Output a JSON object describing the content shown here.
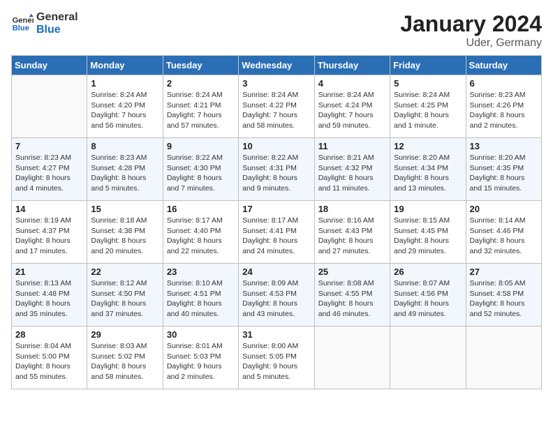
{
  "logo": {
    "line1": "General",
    "line2": "Blue"
  },
  "title": "January 2024",
  "subtitle": "Uder, Germany",
  "weekdays": [
    "Sunday",
    "Monday",
    "Tuesday",
    "Wednesday",
    "Thursday",
    "Friday",
    "Saturday"
  ],
  "weeks": [
    [
      {
        "day": "",
        "empty": true
      },
      {
        "day": "1",
        "sunrise": "8:24 AM",
        "sunset": "4:20 PM",
        "daylight": "7 hours and 56 minutes."
      },
      {
        "day": "2",
        "sunrise": "8:24 AM",
        "sunset": "4:21 PM",
        "daylight": "7 hours and 57 minutes."
      },
      {
        "day": "3",
        "sunrise": "8:24 AM",
        "sunset": "4:22 PM",
        "daylight": "7 hours and 58 minutes."
      },
      {
        "day": "4",
        "sunrise": "8:24 AM",
        "sunset": "4:24 PM",
        "daylight": "7 hours and 59 minutes."
      },
      {
        "day": "5",
        "sunrise": "8:24 AM",
        "sunset": "4:25 PM",
        "daylight": "8 hours and 1 minute."
      },
      {
        "day": "6",
        "sunrise": "8:23 AM",
        "sunset": "4:26 PM",
        "daylight": "8 hours and 2 minutes."
      }
    ],
    [
      {
        "day": "7",
        "sunrise": "8:23 AM",
        "sunset": "4:27 PM",
        "daylight": "8 hours and 4 minutes."
      },
      {
        "day": "8",
        "sunrise": "8:23 AM",
        "sunset": "4:28 PM",
        "daylight": "8 hours and 5 minutes."
      },
      {
        "day": "9",
        "sunrise": "8:22 AM",
        "sunset": "4:30 PM",
        "daylight": "8 hours and 7 minutes."
      },
      {
        "day": "10",
        "sunrise": "8:22 AM",
        "sunset": "4:31 PM",
        "daylight": "8 hours and 9 minutes."
      },
      {
        "day": "11",
        "sunrise": "8:21 AM",
        "sunset": "4:32 PM",
        "daylight": "8 hours and 11 minutes."
      },
      {
        "day": "12",
        "sunrise": "8:20 AM",
        "sunset": "4:34 PM",
        "daylight": "8 hours and 13 minutes."
      },
      {
        "day": "13",
        "sunrise": "8:20 AM",
        "sunset": "4:35 PM",
        "daylight": "8 hours and 15 minutes."
      }
    ],
    [
      {
        "day": "14",
        "sunrise": "8:19 AM",
        "sunset": "4:37 PM",
        "daylight": "8 hours and 17 minutes."
      },
      {
        "day": "15",
        "sunrise": "8:18 AM",
        "sunset": "4:38 PM",
        "daylight": "8 hours and 20 minutes."
      },
      {
        "day": "16",
        "sunrise": "8:17 AM",
        "sunset": "4:40 PM",
        "daylight": "8 hours and 22 minutes."
      },
      {
        "day": "17",
        "sunrise": "8:17 AM",
        "sunset": "4:41 PM",
        "daylight": "8 hours and 24 minutes."
      },
      {
        "day": "18",
        "sunrise": "8:16 AM",
        "sunset": "4:43 PM",
        "daylight": "8 hours and 27 minutes."
      },
      {
        "day": "19",
        "sunrise": "8:15 AM",
        "sunset": "4:45 PM",
        "daylight": "8 hours and 29 minutes."
      },
      {
        "day": "20",
        "sunrise": "8:14 AM",
        "sunset": "4:46 PM",
        "daylight": "8 hours and 32 minutes."
      }
    ],
    [
      {
        "day": "21",
        "sunrise": "8:13 AM",
        "sunset": "4:48 PM",
        "daylight": "8 hours and 35 minutes."
      },
      {
        "day": "22",
        "sunrise": "8:12 AM",
        "sunset": "4:50 PM",
        "daylight": "8 hours and 37 minutes."
      },
      {
        "day": "23",
        "sunrise": "8:10 AM",
        "sunset": "4:51 PM",
        "daylight": "8 hours and 40 minutes."
      },
      {
        "day": "24",
        "sunrise": "8:09 AM",
        "sunset": "4:53 PM",
        "daylight": "8 hours and 43 minutes."
      },
      {
        "day": "25",
        "sunrise": "8:08 AM",
        "sunset": "4:55 PM",
        "daylight": "8 hours and 46 minutes."
      },
      {
        "day": "26",
        "sunrise": "8:07 AM",
        "sunset": "4:56 PM",
        "daylight": "8 hours and 49 minutes."
      },
      {
        "day": "27",
        "sunrise": "8:05 AM",
        "sunset": "4:58 PM",
        "daylight": "8 hours and 52 minutes."
      }
    ],
    [
      {
        "day": "28",
        "sunrise": "8:04 AM",
        "sunset": "5:00 PM",
        "daylight": "8 hours and 55 minutes."
      },
      {
        "day": "29",
        "sunrise": "8:03 AM",
        "sunset": "5:02 PM",
        "daylight": "8 hours and 58 minutes."
      },
      {
        "day": "30",
        "sunrise": "8:01 AM",
        "sunset": "5:03 PM",
        "daylight": "9 hours and 2 minutes."
      },
      {
        "day": "31",
        "sunrise": "8:00 AM",
        "sunset": "5:05 PM",
        "daylight": "9 hours and 5 minutes."
      },
      {
        "day": "",
        "empty": true
      },
      {
        "day": "",
        "empty": true
      },
      {
        "day": "",
        "empty": true
      }
    ]
  ]
}
